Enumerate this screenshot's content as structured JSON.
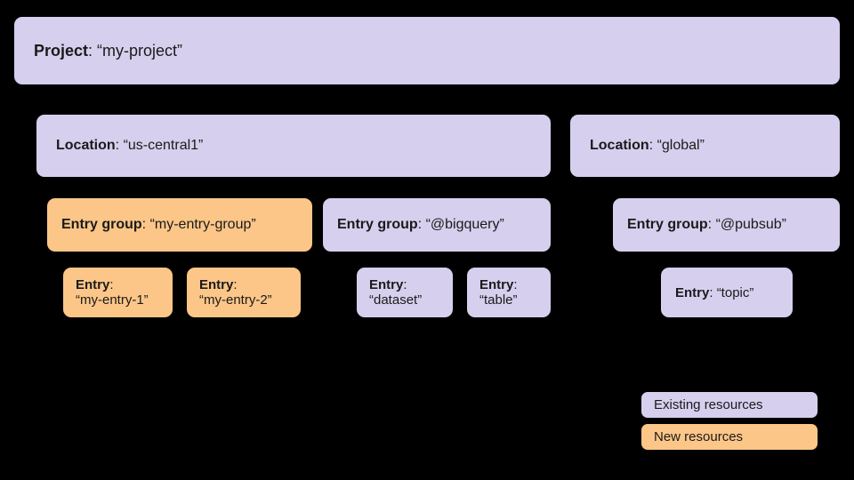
{
  "colors": {
    "existing": "#d7cfee",
    "new": "#fcc688"
  },
  "project": {
    "label": "Project",
    "value": "“my-project”"
  },
  "locations": [
    {
      "label": "Location",
      "value": "“us-central1”"
    },
    {
      "label": "Location",
      "value": "“global”"
    }
  ],
  "entry_groups": [
    {
      "label": "Entry group",
      "value": "“my-entry-group”",
      "kind": "new"
    },
    {
      "label": "Entry group",
      "value": "“@bigquery”",
      "kind": "existing"
    },
    {
      "label": "Entry group",
      "value": "“@pubsub”",
      "kind": "existing"
    }
  ],
  "entries": [
    {
      "label": "Entry",
      "value": "“my-entry-1”",
      "kind": "new"
    },
    {
      "label": "Entry",
      "value": "“my-entry-2”",
      "kind": "new"
    },
    {
      "label": "Entry",
      "value": "“dataset”",
      "kind": "existing"
    },
    {
      "label": "Entry",
      "value": "“table”",
      "kind": "existing"
    },
    {
      "label": "Entry",
      "value": "“topic”",
      "kind": "existing"
    }
  ],
  "legend": {
    "existing": "Existing resources",
    "new": "New resources"
  }
}
